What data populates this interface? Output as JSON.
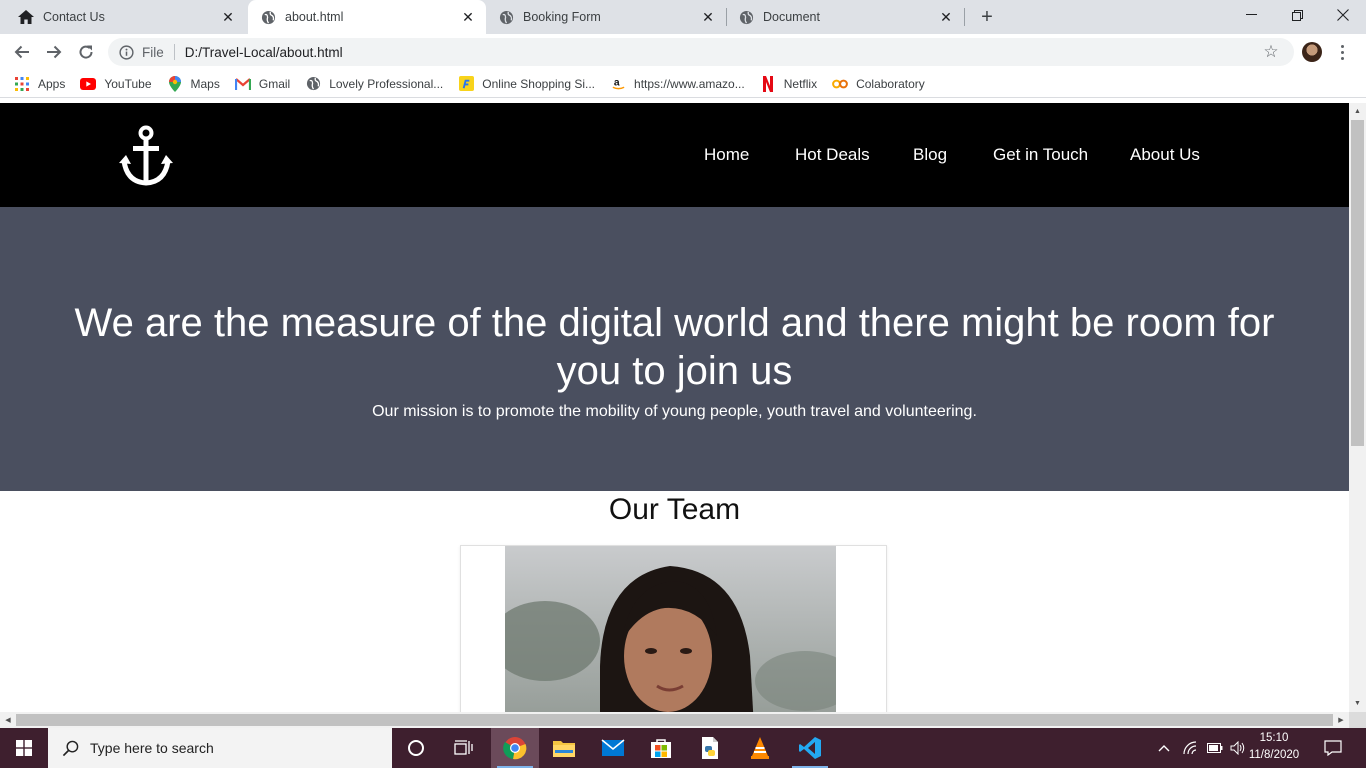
{
  "browser": {
    "tabs": [
      {
        "title": "Contact Us",
        "icon": "home-icon",
        "active": false
      },
      {
        "title": "about.html",
        "icon": "globe-icon",
        "active": true
      },
      {
        "title": "Booking Form",
        "icon": "globe-icon",
        "active": false
      },
      {
        "title": "Document",
        "icon": "globe-icon",
        "active": false
      }
    ],
    "address": {
      "scheme_label": "File",
      "url": "D:/Travel-Local/about.html"
    },
    "bookmarks": [
      {
        "label": "Apps",
        "icon": "apps-grid-icon"
      },
      {
        "label": "YouTube",
        "icon": "youtube-icon"
      },
      {
        "label": "Maps",
        "icon": "maps-pin-icon"
      },
      {
        "label": "Gmail",
        "icon": "gmail-icon"
      },
      {
        "label": "Lovely Professional...",
        "icon": "globe-icon"
      },
      {
        "label": "Online Shopping Si...",
        "icon": "flipkart-icon"
      },
      {
        "label": "https://www.amazo...",
        "icon": "amazon-icon"
      },
      {
        "label": "Netflix",
        "icon": "netflix-icon"
      },
      {
        "label": "Colaboratory",
        "icon": "colab-icon"
      }
    ]
  },
  "site": {
    "logo_icon": "anchor-icon",
    "nav": [
      "Home",
      "Hot Deals",
      "Blog",
      "Get in Touch",
      "About Us"
    ],
    "hero": {
      "heading": "We are the measure of the digital world and there might be room for you to join us",
      "subheading": "Our mission is to promote the mobility of young people, youth travel and volunteering."
    },
    "team_title": "Our Team"
  },
  "taskbar": {
    "search_placeholder": "Type here to search",
    "time": "15:10",
    "date": "11/8/2020"
  },
  "colors": {
    "nav_bg": "#000000",
    "hero_bg": "#4a4f5f",
    "taskbar_bg": "#3e1f2e"
  }
}
